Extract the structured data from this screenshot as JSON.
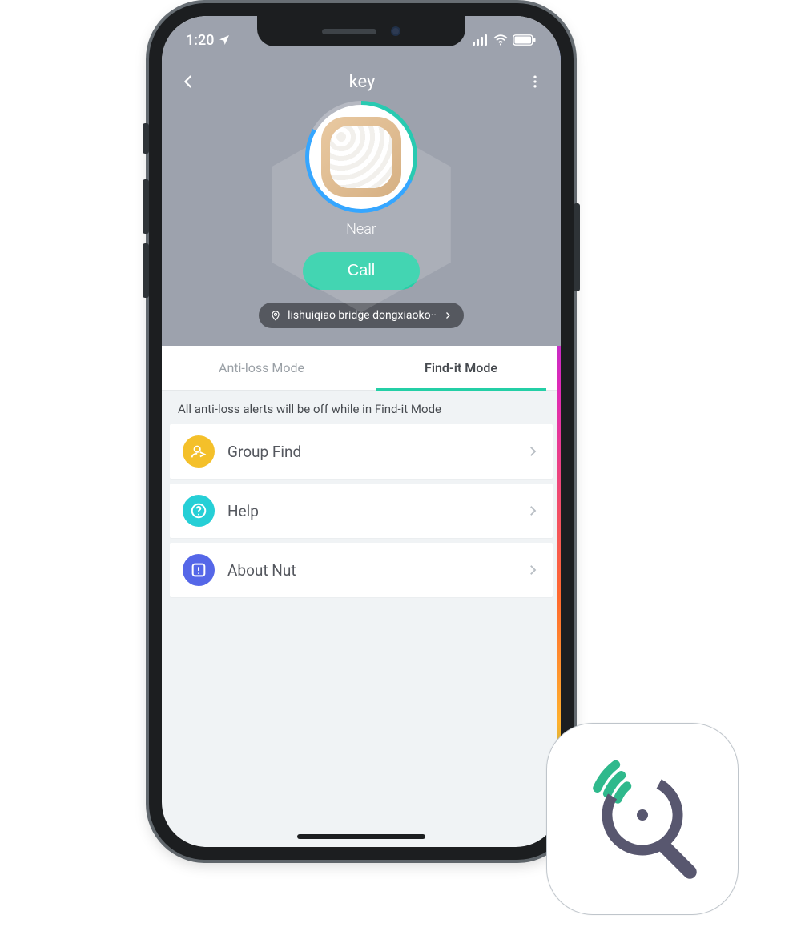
{
  "status": {
    "time": "1:20"
  },
  "header": {
    "title": "key"
  },
  "device": {
    "proximity": "Near"
  },
  "actions": {
    "call": "Call"
  },
  "location": {
    "text": "lishuiqiao bridge dongxiaoko··"
  },
  "tabs": {
    "anti_loss": "Anti-loss Mode",
    "find_it": "Find-it Mode"
  },
  "note": "All anti-loss alerts will be off while in Find-it Mode",
  "list": {
    "group_find": "Group Find",
    "help": "Help",
    "about": "About Nut"
  },
  "colors": {
    "accent": "#24cfa6",
    "group_find_icon": "#f4c02a",
    "help_icon": "#26cfd6",
    "about_icon": "#5567e8"
  }
}
